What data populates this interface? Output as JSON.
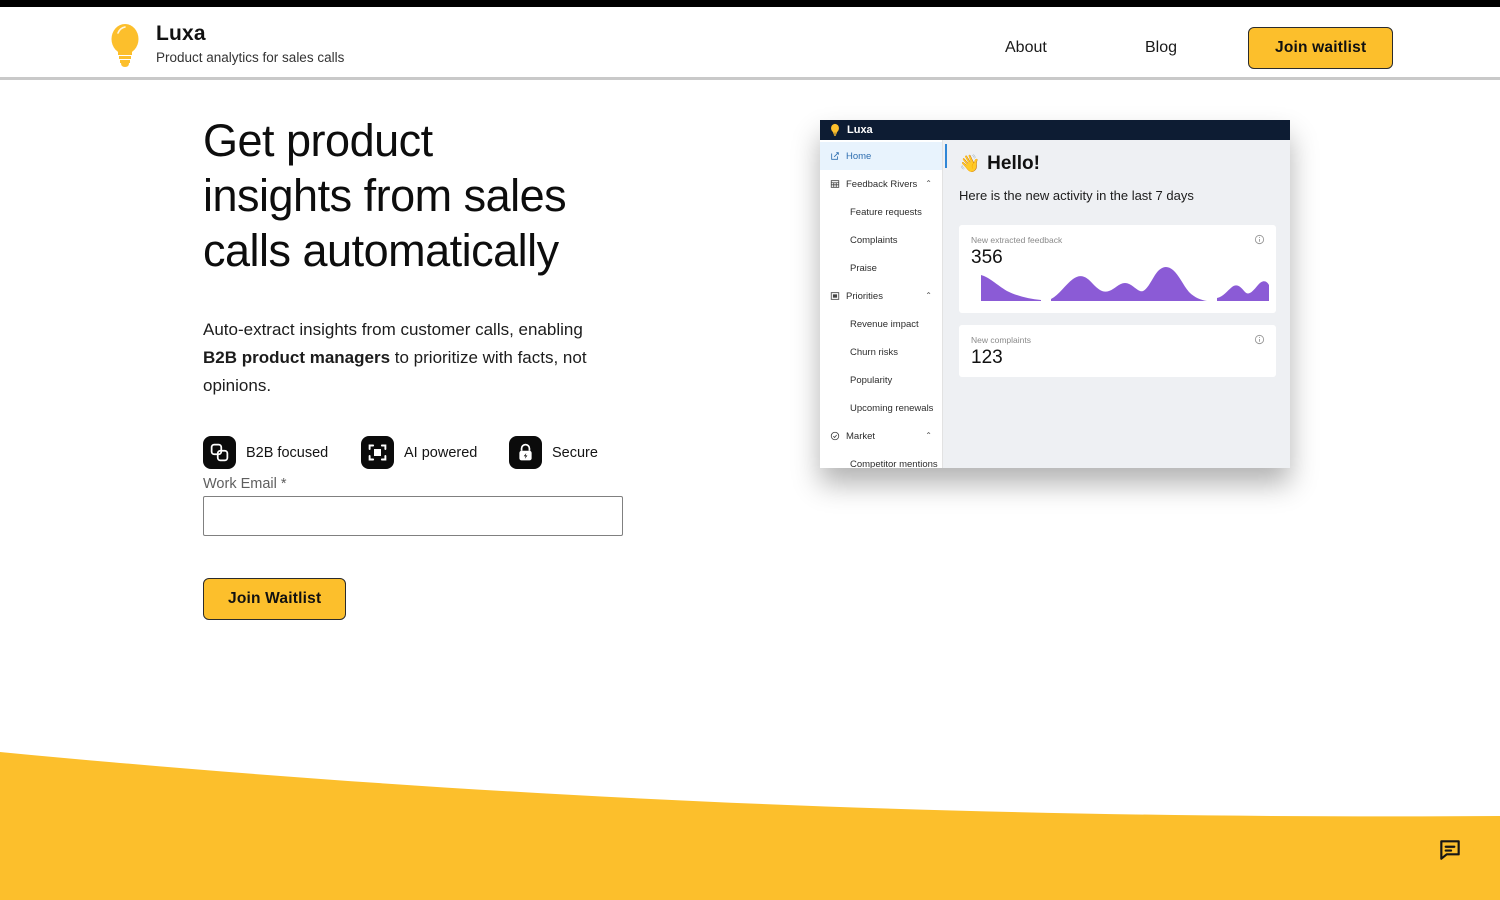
{
  "header": {
    "brand_name": "Luxa",
    "tagline": "Product analytics for sales calls",
    "logo_icon": "lightbulb-icon",
    "nav": [
      {
        "label": "About",
        "name": "nav-about"
      },
      {
        "label": "Blog",
        "name": "nav-blog"
      }
    ],
    "cta_label": "Join waitlist",
    "cta_color": "#fcbf2c"
  },
  "hero": {
    "headline": "Get product\ninsights from sales\ncalls automatically",
    "subhead_part1": "Auto-extract insights from customer calls, enabling ",
    "subhead_bold": "B2B product managers",
    "subhead_part2": " to prioritize with facts, not opinions.",
    "badges": [
      {
        "label": "B2B focused",
        "icon": "linked-squares-icon"
      },
      {
        "label": "AI powered",
        "icon": "focus-frame-icon"
      },
      {
        "label": "Secure",
        "icon": "lock-bolt-icon"
      }
    ]
  },
  "form": {
    "email_label": "Work Email *",
    "email_value": "",
    "email_placeholder": "",
    "submit_label": "Join Waitlist"
  },
  "mockup": {
    "brand": "Luxa",
    "topbar_color": "#0d1c33",
    "sidebar": [
      {
        "label": "Home",
        "icon": "edit-square-icon",
        "type": "item",
        "active": true
      },
      {
        "label": "Feedback Rivers",
        "icon": "table-grid-icon",
        "type": "item",
        "chevron": "⌃"
      },
      {
        "label": "Feature requests",
        "type": "sub"
      },
      {
        "label": "Complaints",
        "type": "sub"
      },
      {
        "label": "Praise",
        "type": "sub"
      },
      {
        "label": "Priorities",
        "icon": "layout-icon",
        "type": "item",
        "chevron": "⌃"
      },
      {
        "label": "Revenue impact",
        "type": "sub"
      },
      {
        "label": "Churn risks",
        "type": "sub"
      },
      {
        "label": "Popularity",
        "type": "sub"
      },
      {
        "label": "Upcoming renewals",
        "type": "sub"
      },
      {
        "label": "Market",
        "icon": "check-circle-icon",
        "type": "item",
        "chevron": "⌃"
      },
      {
        "label": "Competitor mentions",
        "type": "sub"
      }
    ],
    "greeting": "Hello!",
    "greeting_emoji": "👋",
    "greeting_sub": "Here is the new activity in the last 7 days",
    "cards": [
      {
        "title": "New extracted feedback",
        "value": "356",
        "info_icon": "info-icon"
      },
      {
        "title": "New complaints",
        "value": "123",
        "info_icon": "info-icon"
      }
    ],
    "spark_color": "#8b5bd6"
  },
  "chart_data": {
    "type": "area",
    "title": "New extracted feedback",
    "series": [
      {
        "name": "segment-1",
        "values": [
          26,
          22,
          14,
          9,
          6,
          3,
          1
        ]
      },
      {
        "name": "segment-2",
        "values": [
          2,
          14,
          24,
          20,
          12,
          17,
          22,
          13,
          9,
          30,
          34,
          24,
          14,
          4
        ]
      },
      {
        "name": "segment-3",
        "values": [
          2,
          10,
          14,
          7,
          3,
          12,
          18,
          16
        ]
      }
    ],
    "ylim": [
      0,
      36
    ],
    "grid": false,
    "legend": "none"
  },
  "chat": {
    "icon": "chat-bubble-icon",
    "color": "#fcbf2c"
  },
  "theme": {
    "accent_yellow": "#fcbf2c",
    "ink": "#111111",
    "wave_color": "#fcbf2c"
  }
}
